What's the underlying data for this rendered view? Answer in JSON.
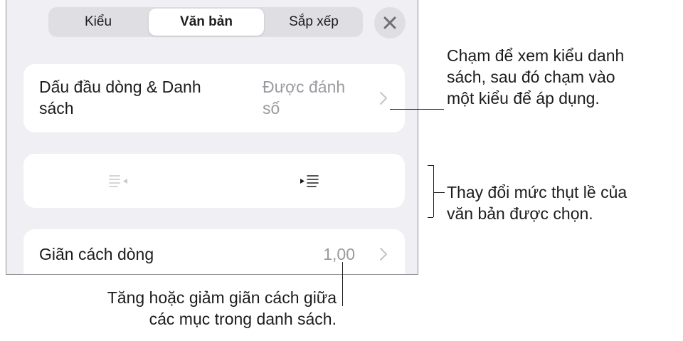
{
  "tabs": [
    {
      "label": "Kiểu",
      "active": false
    },
    {
      "label": "Văn bản",
      "active": true
    },
    {
      "label": "Sắp xếp",
      "active": false
    }
  ],
  "close_icon": "close-icon",
  "bullets_row": {
    "label": "Dấu đầu dòng & Danh\nsách",
    "value": "Được đánh\nsố"
  },
  "indent_controls": {
    "decrease_icon": "decrease-indent-icon",
    "increase_icon": "increase-indent-icon"
  },
  "spacing_row": {
    "label": "Giãn cách dòng",
    "value": "1,00"
  },
  "callouts": {
    "bullets": "Chạm để xem kiểu danh\nsách, sau đó chạm vào\nmột kiểu để áp dụng.",
    "indent": "Thay đổi mức thụt lề của\nvăn bản được chọn.",
    "spacing": "Tăng hoặc giảm giãn cách giữa\ncác mục trong danh sách."
  },
  "colors": {
    "panel_bg": "#efeff4",
    "secondary_text": "#9a9aa0",
    "chevron": "#c4c4c8"
  }
}
